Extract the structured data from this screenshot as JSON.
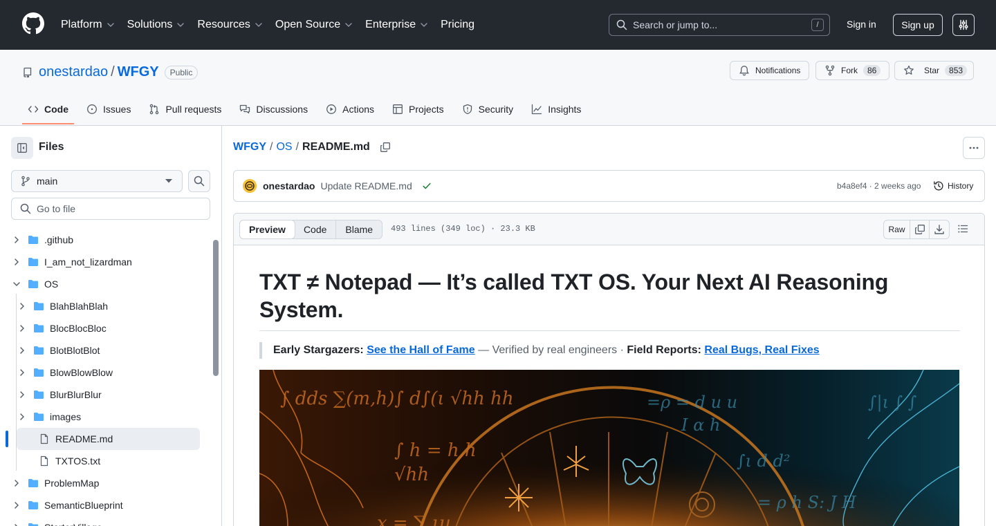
{
  "header": {
    "nav": [
      "Platform",
      "Solutions",
      "Resources",
      "Open Source",
      "Enterprise",
      "Pricing"
    ],
    "nav_has_chevron": [
      true,
      true,
      true,
      true,
      true,
      false
    ],
    "search_placeholder": "Search or jump to...",
    "search_key": "/",
    "signin": "Sign in",
    "signup": "Sign up"
  },
  "repo": {
    "owner": "onestardao",
    "separator": "/",
    "name": "WFGY",
    "visibility": "Public",
    "notifications": "Notifications",
    "fork_label": "Fork",
    "fork_count": "86",
    "star_label": "Star",
    "star_count": "853",
    "tabs": [
      "Code",
      "Issues",
      "Pull requests",
      "Discussions",
      "Actions",
      "Projects",
      "Security",
      "Insights"
    ]
  },
  "sidebar": {
    "title": "Files",
    "branch": "main",
    "goto_placeholder": "Go to file",
    "tree": [
      {
        "label": ".github",
        "type": "folder",
        "depth": 0,
        "expanded": false
      },
      {
        "label": "I_am_not_lizardman",
        "type": "folder",
        "depth": 0,
        "expanded": false
      },
      {
        "label": "OS",
        "type": "folder",
        "depth": 0,
        "expanded": true
      },
      {
        "label": "BlahBlahBlah",
        "type": "folder",
        "depth": 1,
        "expanded": false
      },
      {
        "label": "BlocBlocBloc",
        "type": "folder",
        "depth": 1,
        "expanded": false
      },
      {
        "label": "BlotBlotBlot",
        "type": "folder",
        "depth": 1,
        "expanded": false
      },
      {
        "label": "BlowBlowBlow",
        "type": "folder",
        "depth": 1,
        "expanded": false
      },
      {
        "label": "BlurBlurBlur",
        "type": "folder",
        "depth": 1,
        "expanded": false
      },
      {
        "label": "images",
        "type": "folder",
        "depth": 1,
        "expanded": false
      },
      {
        "label": "README.md",
        "type": "file",
        "depth": 1,
        "selected": true
      },
      {
        "label": "TXTOS.txt",
        "type": "file",
        "depth": 1
      },
      {
        "label": "ProblemMap",
        "type": "folder",
        "depth": 0,
        "expanded": false
      },
      {
        "label": "SemanticBlueprint",
        "type": "folder",
        "depth": 0,
        "expanded": false
      },
      {
        "label": "StarterVillage",
        "type": "folder",
        "depth": 0,
        "expanded": false
      }
    ]
  },
  "breadcrumb": {
    "repo": "WFGY",
    "dir": "OS",
    "sep": "/",
    "file": "README.md"
  },
  "commit": {
    "author": "onestardao",
    "message": "Update README.md",
    "sha_time": "b4a8ef4 · 2 weeks ago",
    "history": "History"
  },
  "file": {
    "views": [
      "Preview",
      "Code",
      "Blame"
    ],
    "info": "493 lines (349 loc) · 23.3 KB",
    "raw": "Raw"
  },
  "readme": {
    "h1": "TXT ≠ Notepad — It’s called TXT OS. Your Next AI Reasoning System.",
    "quote_icon1": "",
    "quote_label1": "Early Stargazers:",
    "quote_link1": "See the Hall of Fame",
    "quote_mid": "— Verified by real engineers ·",
    "quote_icon2": "",
    "quote_label2": "Field Reports:",
    "quote_link2": "Real Bugs, Real Fixes"
  },
  "colors": {
    "header_bg": "#24292f",
    "link": "#0969da",
    "folder": "#54aeff",
    "tab_underline": "#fd8c73",
    "success": "#1a7f37"
  }
}
